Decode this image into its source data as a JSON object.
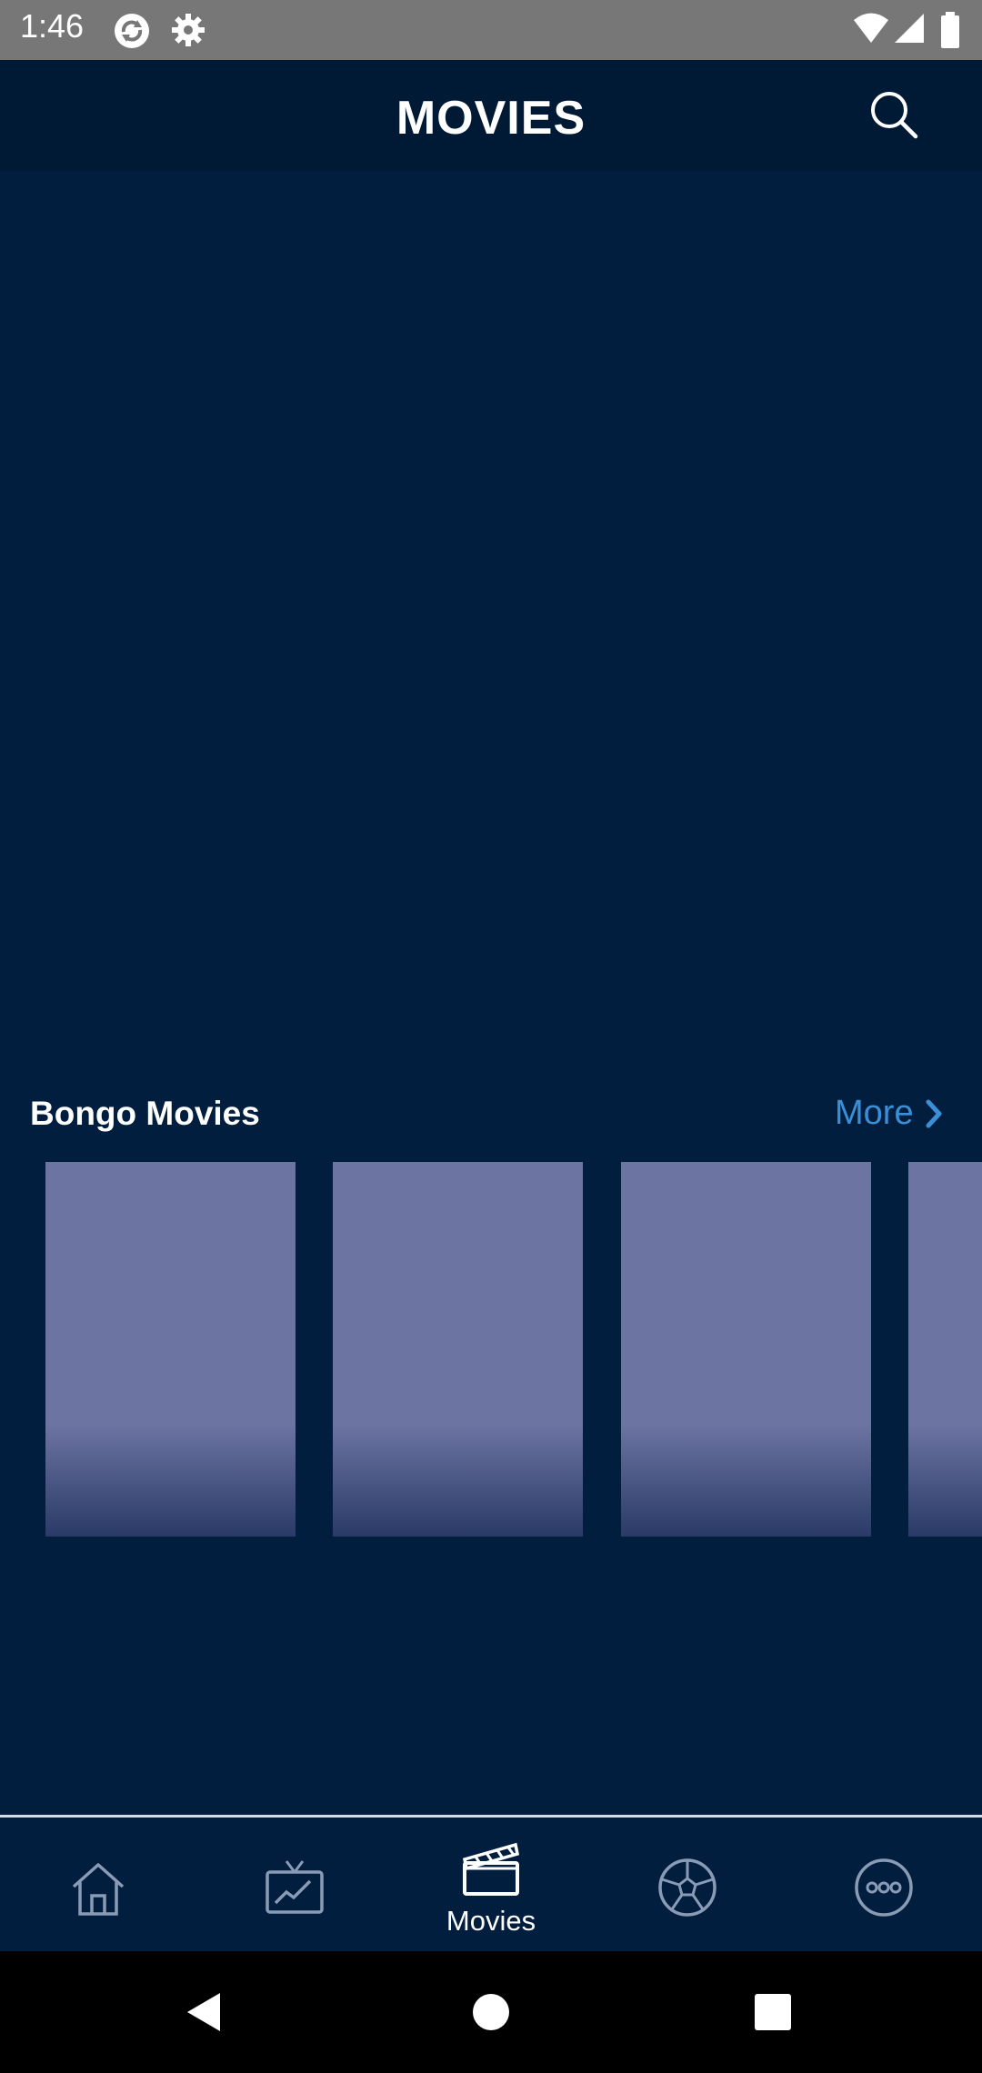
{
  "status_bar": {
    "time": "1:46",
    "left_icons": [
      "sync-app-icon",
      "settings-gear-icon"
    ],
    "right_icons": [
      "wifi-icon",
      "cellular-signal-icon",
      "battery-icon"
    ]
  },
  "app_bar": {
    "title": "MOVIES",
    "search_icon": "search-icon"
  },
  "section": {
    "title": "Bongo Movies",
    "more_label": "More",
    "more_icon": "chevron-right-icon",
    "posters_visible": 4
  },
  "bottom_nav": {
    "items": [
      {
        "name": "home",
        "icon": "home-icon",
        "label": "",
        "active": false
      },
      {
        "name": "tv",
        "icon": "tv-icon",
        "label": "",
        "active": false
      },
      {
        "name": "movies",
        "icon": "clapperboard-icon",
        "label": "Movies",
        "active": true
      },
      {
        "name": "sports",
        "icon": "soccer-ball-icon",
        "label": "",
        "active": false
      },
      {
        "name": "more",
        "icon": "more-icon",
        "label": "",
        "active": false
      }
    ]
  },
  "system_nav": {
    "back": "back-icon",
    "home": "home-circle-icon",
    "recents": "recents-icon"
  },
  "colors": {
    "background": "#011e3f",
    "app_bar": "#001a36",
    "accent": "#3b8fd6",
    "poster_placeholder": "#6c74a2",
    "inactive_icon": "#8a9bb5"
  }
}
